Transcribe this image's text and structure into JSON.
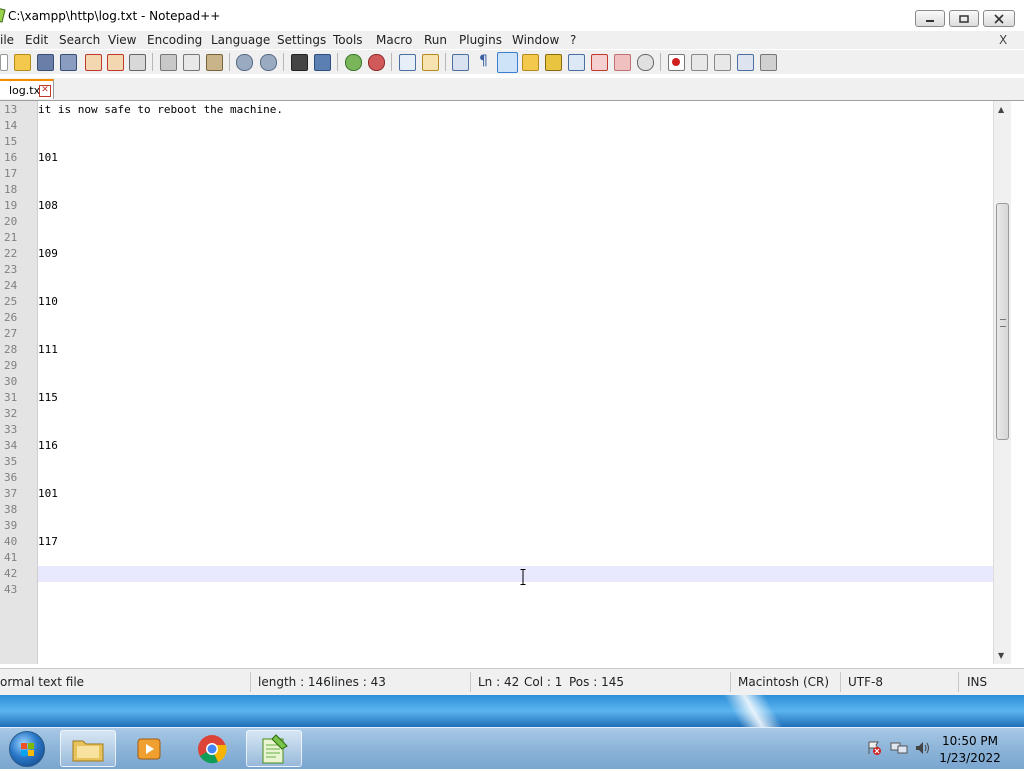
{
  "window": {
    "title": "C:\\xampp\\http\\log.txt - Notepad++"
  },
  "menu": {
    "items": [
      "ile",
      "Edit",
      "Search",
      "View",
      "Encoding",
      "Language",
      "Settings",
      "Tools",
      "Macro",
      "Run",
      "Plugins",
      "Window",
      "?"
    ],
    "close_label": "X"
  },
  "tabs": [
    {
      "label": "log.txt",
      "active": true
    }
  ],
  "editor": {
    "lines": [
      {
        "n": "13",
        "text": "it is now safe to reboot the machine."
      },
      {
        "n": "14",
        "text": ""
      },
      {
        "n": "15",
        "text": ""
      },
      {
        "n": "16",
        "text": "101"
      },
      {
        "n": "17",
        "text": ""
      },
      {
        "n": "18",
        "text": ""
      },
      {
        "n": "19",
        "text": "108"
      },
      {
        "n": "20",
        "text": ""
      },
      {
        "n": "21",
        "text": ""
      },
      {
        "n": "22",
        "text": "109"
      },
      {
        "n": "23",
        "text": ""
      },
      {
        "n": "24",
        "text": ""
      },
      {
        "n": "25",
        "text": "110"
      },
      {
        "n": "26",
        "text": ""
      },
      {
        "n": "27",
        "text": ""
      },
      {
        "n": "28",
        "text": "111"
      },
      {
        "n": "29",
        "text": ""
      },
      {
        "n": "30",
        "text": ""
      },
      {
        "n": "31",
        "text": "115"
      },
      {
        "n": "32",
        "text": ""
      },
      {
        "n": "33",
        "text": ""
      },
      {
        "n": "34",
        "text": "116"
      },
      {
        "n": "35",
        "text": ""
      },
      {
        "n": "36",
        "text": ""
      },
      {
        "n": "37",
        "text": "101"
      },
      {
        "n": "38",
        "text": ""
      },
      {
        "n": "39",
        "text": ""
      },
      {
        "n": "40",
        "text": "117"
      },
      {
        "n": "41",
        "text": ""
      },
      {
        "n": "42",
        "text": ""
      },
      {
        "n": "43",
        "text": ""
      }
    ],
    "current_line": "42"
  },
  "status": {
    "file_type": "ormal text file",
    "length": "length : 146",
    "lines": "lines : 43",
    "ln": "Ln : 42",
    "col": "Col : 1",
    "pos": "Pos : 145",
    "eol": "Macintosh (CR)",
    "encoding": "UTF-8",
    "mode": "INS"
  },
  "taskbar": {
    "apps": [
      "folder-icon",
      "media-player-icon",
      "chrome-icon",
      "notepadpp-icon"
    ],
    "active_app": "notepadpp-icon",
    "time": "10:50 PM",
    "date": "1/23/2022"
  },
  "colors": {
    "current_line": "#e8e8ff",
    "gutter": "#e4e4e4",
    "tab_accent": "#fa8a00",
    "taskbar": "#8fb6da"
  }
}
